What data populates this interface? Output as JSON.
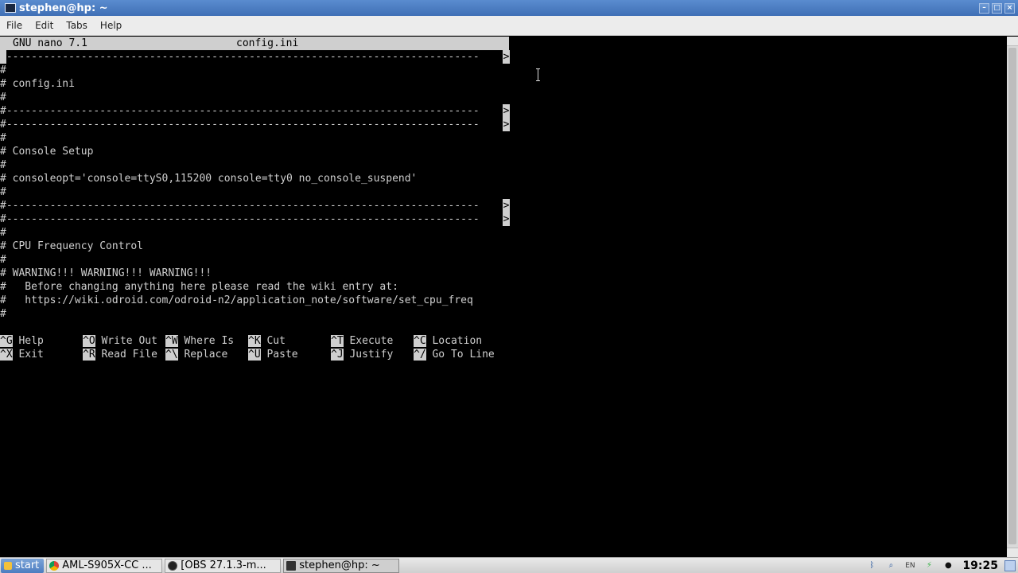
{
  "window": {
    "title": "stephen@hp: ~"
  },
  "menu": [
    "File",
    "Edit",
    "Tabs",
    "Help"
  ],
  "nano": {
    "version": "GNU nano 7.1",
    "filename": "config.ini",
    "lines": [
      "#----------------------------------------------------------------------------",
      "#",
      "# config.ini",
      "#",
      "#----------------------------------------------------------------------------",
      "#----------------------------------------------------------------------------",
      "#",
      "# Console Setup",
      "#",
      "# consoleopt='console=ttyS0,115200 console=tty0 no_console_suspend'",
      "#",
      "#----------------------------------------------------------------------------",
      "#----------------------------------------------------------------------------",
      "#",
      "# CPU Frequency Control",
      "#",
      "# WARNING!!! WARNING!!! WARNING!!!",
      "#   Before changing anything here please read the wiki entry at:",
      "#   https://wiki.odroid.com/odroid-n2/application_note/software/set_cpu_freq",
      "#"
    ],
    "overflow_marker": ">",
    "shortcuts": [
      [
        {
          "key": "^G",
          "label": "Help"
        },
        {
          "key": "^O",
          "label": "Write Out"
        },
        {
          "key": "^W",
          "label": "Where Is"
        },
        {
          "key": "^K",
          "label": "Cut"
        },
        {
          "key": "^T",
          "label": "Execute"
        },
        {
          "key": "^C",
          "label": "Location"
        }
      ],
      [
        {
          "key": "^X",
          "label": "Exit"
        },
        {
          "key": "^R",
          "label": "Read File"
        },
        {
          "key": "^\\",
          "label": "Replace"
        },
        {
          "key": "^U",
          "label": "Paste"
        },
        {
          "key": "^J",
          "label": "Justify"
        },
        {
          "key": "^/",
          "label": "Go To Line"
        }
      ]
    ]
  },
  "taskbar": {
    "start": "start",
    "tasks": [
      {
        "label": "AML-S905X-CC ..."
      },
      {
        "label": "[OBS 27.1.3-m..."
      },
      {
        "label": "stephen@hp: ~"
      }
    ],
    "keyboard_layout": "EN",
    "clock": "19:25"
  }
}
